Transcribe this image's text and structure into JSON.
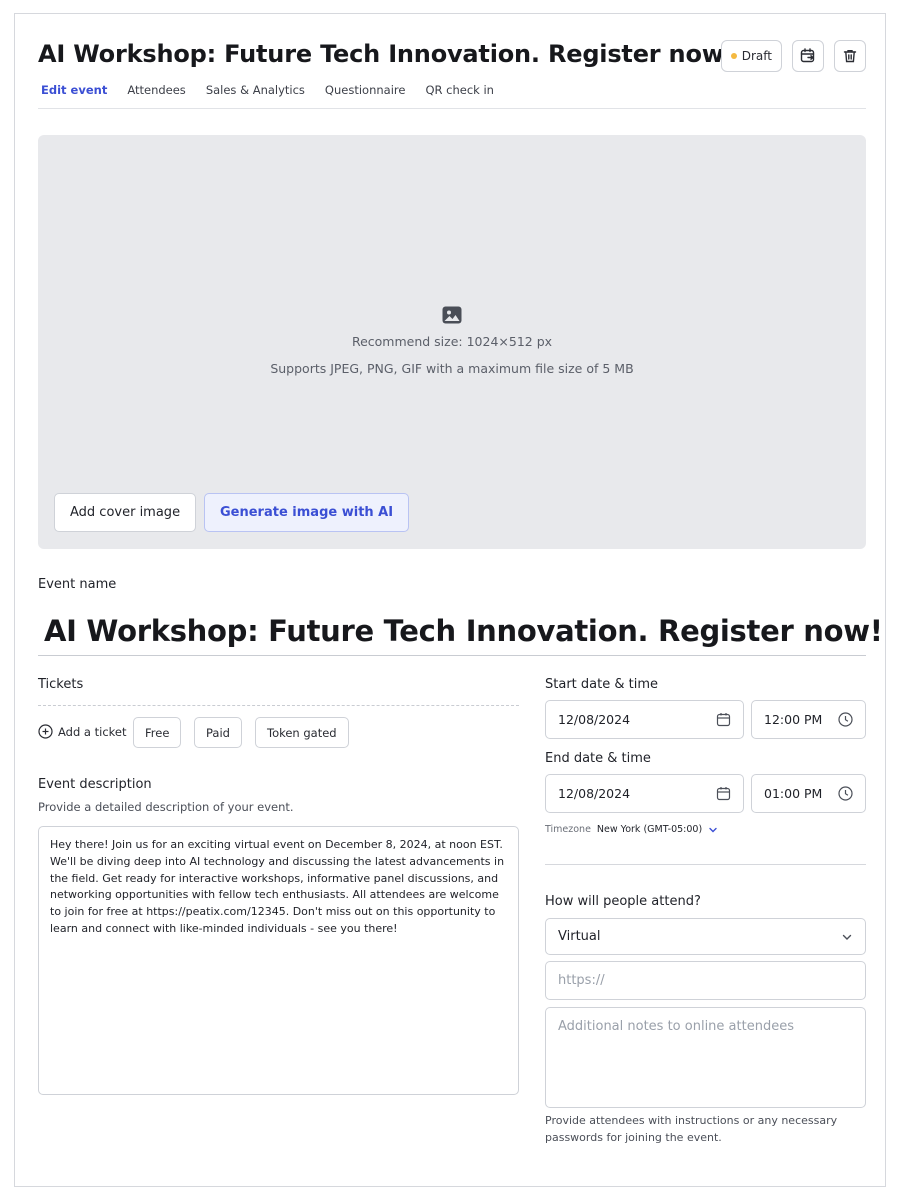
{
  "header": {
    "title": "AI Workshop: Future Tech Innovation. Register now!",
    "status_badge": "Draft",
    "status_color": "#f4b940"
  },
  "tabs": [
    {
      "label": "Edit event",
      "active": true
    },
    {
      "label": "Attendees",
      "active": false
    },
    {
      "label": "Sales & Analytics",
      "active": false
    },
    {
      "label": "Questionnaire",
      "active": false
    },
    {
      "label": "QR check in",
      "active": false
    }
  ],
  "cover": {
    "recommend_text": "Recommend size: 1024×512 px",
    "support_text": "Supports JPEG, PNG, GIF with a maximum file size of 5 MB",
    "add_button": "Add cover image",
    "ai_button": "Generate image with AI"
  },
  "event_name": {
    "label": "Event name",
    "value": "AI Workshop: Future Tech Innovation. Register now!"
  },
  "tickets": {
    "label": "Tickets",
    "add_label": "Add a ticket",
    "options": [
      "Free",
      "Paid",
      "Token gated"
    ]
  },
  "description": {
    "label": "Event description",
    "sublabel": "Provide a detailed description of your event.",
    "value": "Hey there! Join us for an exciting virtual event on December 8, 2024, at noon EST. We'll be diving deep into AI technology and discussing the latest advancements in the field. Get ready for interactive workshops, informative panel discussions, and networking opportunities with fellow tech enthusiasts. All attendees are welcome to join for free at https://peatix.com/12345. Don't miss out on this opportunity to learn and connect with like-minded individuals - see you there!"
  },
  "schedule": {
    "start_label": "Start date & time",
    "start_date": "12/08/2024",
    "start_time": "12:00 PM",
    "end_label": "End date & time",
    "end_date": "12/08/2024",
    "end_time": "01:00 PM",
    "timezone_label": "Timezone",
    "timezone_value": "New York (GMT-05:00)"
  },
  "attendance": {
    "label": "How will people attend?",
    "mode": "Virtual",
    "url_placeholder": "https://",
    "notes_placeholder": "Additional notes to online attendees",
    "help_text": "Provide attendees with instructions or any necessary passwords for joining the event."
  },
  "colors": {
    "accent": "#3b4fd4",
    "cover_bg": "#e8e9ec"
  }
}
